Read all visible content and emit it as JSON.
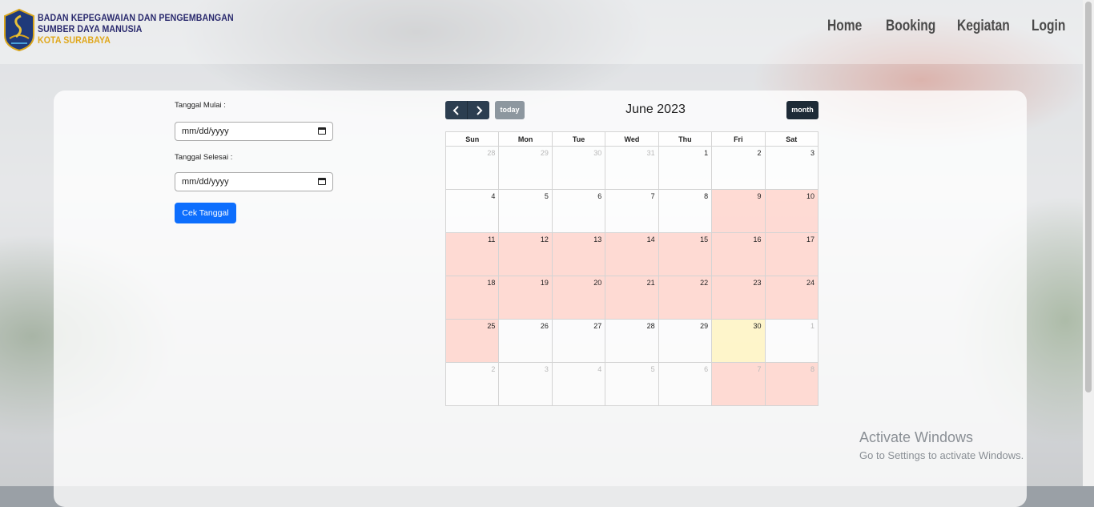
{
  "brand": {
    "line1": "BADAN KEPEGAWAIAN DAN PENGEMBANGAN",
    "line2": "SUMBER DAYA MANUSIA",
    "line3": "KOTA SURABAYA"
  },
  "nav": [
    {
      "label": "Home"
    },
    {
      "label": "Booking"
    },
    {
      "label": "Kegiatan"
    },
    {
      "label": "Login"
    }
  ],
  "form": {
    "start_label": "Tanggal Mulai :",
    "start_value": "mm/dd/yyyy",
    "end_label": "Tanggal Selesai :",
    "end_value": "mm/dd/yyyy",
    "submit_label": "Cek Tanggal"
  },
  "calendar": {
    "title": "June 2023",
    "today_label": "today",
    "month_label": "month",
    "weekdays": [
      "Sun",
      "Mon",
      "Tue",
      "Wed",
      "Thu",
      "Fri",
      "Sat"
    ],
    "weeks": [
      [
        {
          "d": "28",
          "o": true
        },
        {
          "d": "29",
          "o": true
        },
        {
          "d": "30",
          "o": true
        },
        {
          "d": "31",
          "o": true
        },
        {
          "d": "1"
        },
        {
          "d": "2"
        },
        {
          "d": "3"
        }
      ],
      [
        {
          "d": "4"
        },
        {
          "d": "5"
        },
        {
          "d": "6"
        },
        {
          "d": "7"
        },
        {
          "d": "8"
        },
        {
          "d": "9",
          "b": true
        },
        {
          "d": "10",
          "b": true
        }
      ],
      [
        {
          "d": "11",
          "b": true
        },
        {
          "d": "12",
          "b": true
        },
        {
          "d": "13",
          "b": true
        },
        {
          "d": "14",
          "b": true
        },
        {
          "d": "15",
          "b": true
        },
        {
          "d": "16",
          "b": true
        },
        {
          "d": "17",
          "b": true
        }
      ],
      [
        {
          "d": "18",
          "b": true
        },
        {
          "d": "19",
          "b": true
        },
        {
          "d": "20",
          "b": true
        },
        {
          "d": "21",
          "b": true
        },
        {
          "d": "22",
          "b": true
        },
        {
          "d": "23",
          "b": true
        },
        {
          "d": "24",
          "b": true
        }
      ],
      [
        {
          "d": "25",
          "b": true
        },
        {
          "d": "26"
        },
        {
          "d": "27"
        },
        {
          "d": "28"
        },
        {
          "d": "29"
        },
        {
          "d": "30",
          "t": true
        },
        {
          "d": "1",
          "o": true
        }
      ],
      [
        {
          "d": "2",
          "o": true
        },
        {
          "d": "3",
          "o": true
        },
        {
          "d": "4",
          "o": true
        },
        {
          "d": "5",
          "o": true
        },
        {
          "d": "6",
          "o": true
        },
        {
          "d": "7",
          "o": true,
          "b": true
        },
        {
          "d": "8",
          "o": true,
          "b": true
        }
      ]
    ]
  },
  "watermark": {
    "line1": "Activate Windows",
    "line2": "Go to Settings to activate Windows."
  },
  "colors": {
    "primary": "#0d6efd",
    "booked": "#ffcdc3",
    "today": "#fff4be",
    "fc_button": "#2c3e50",
    "brand_gold": "#e0a81c",
    "brand_navy": "#2a2a6e"
  }
}
